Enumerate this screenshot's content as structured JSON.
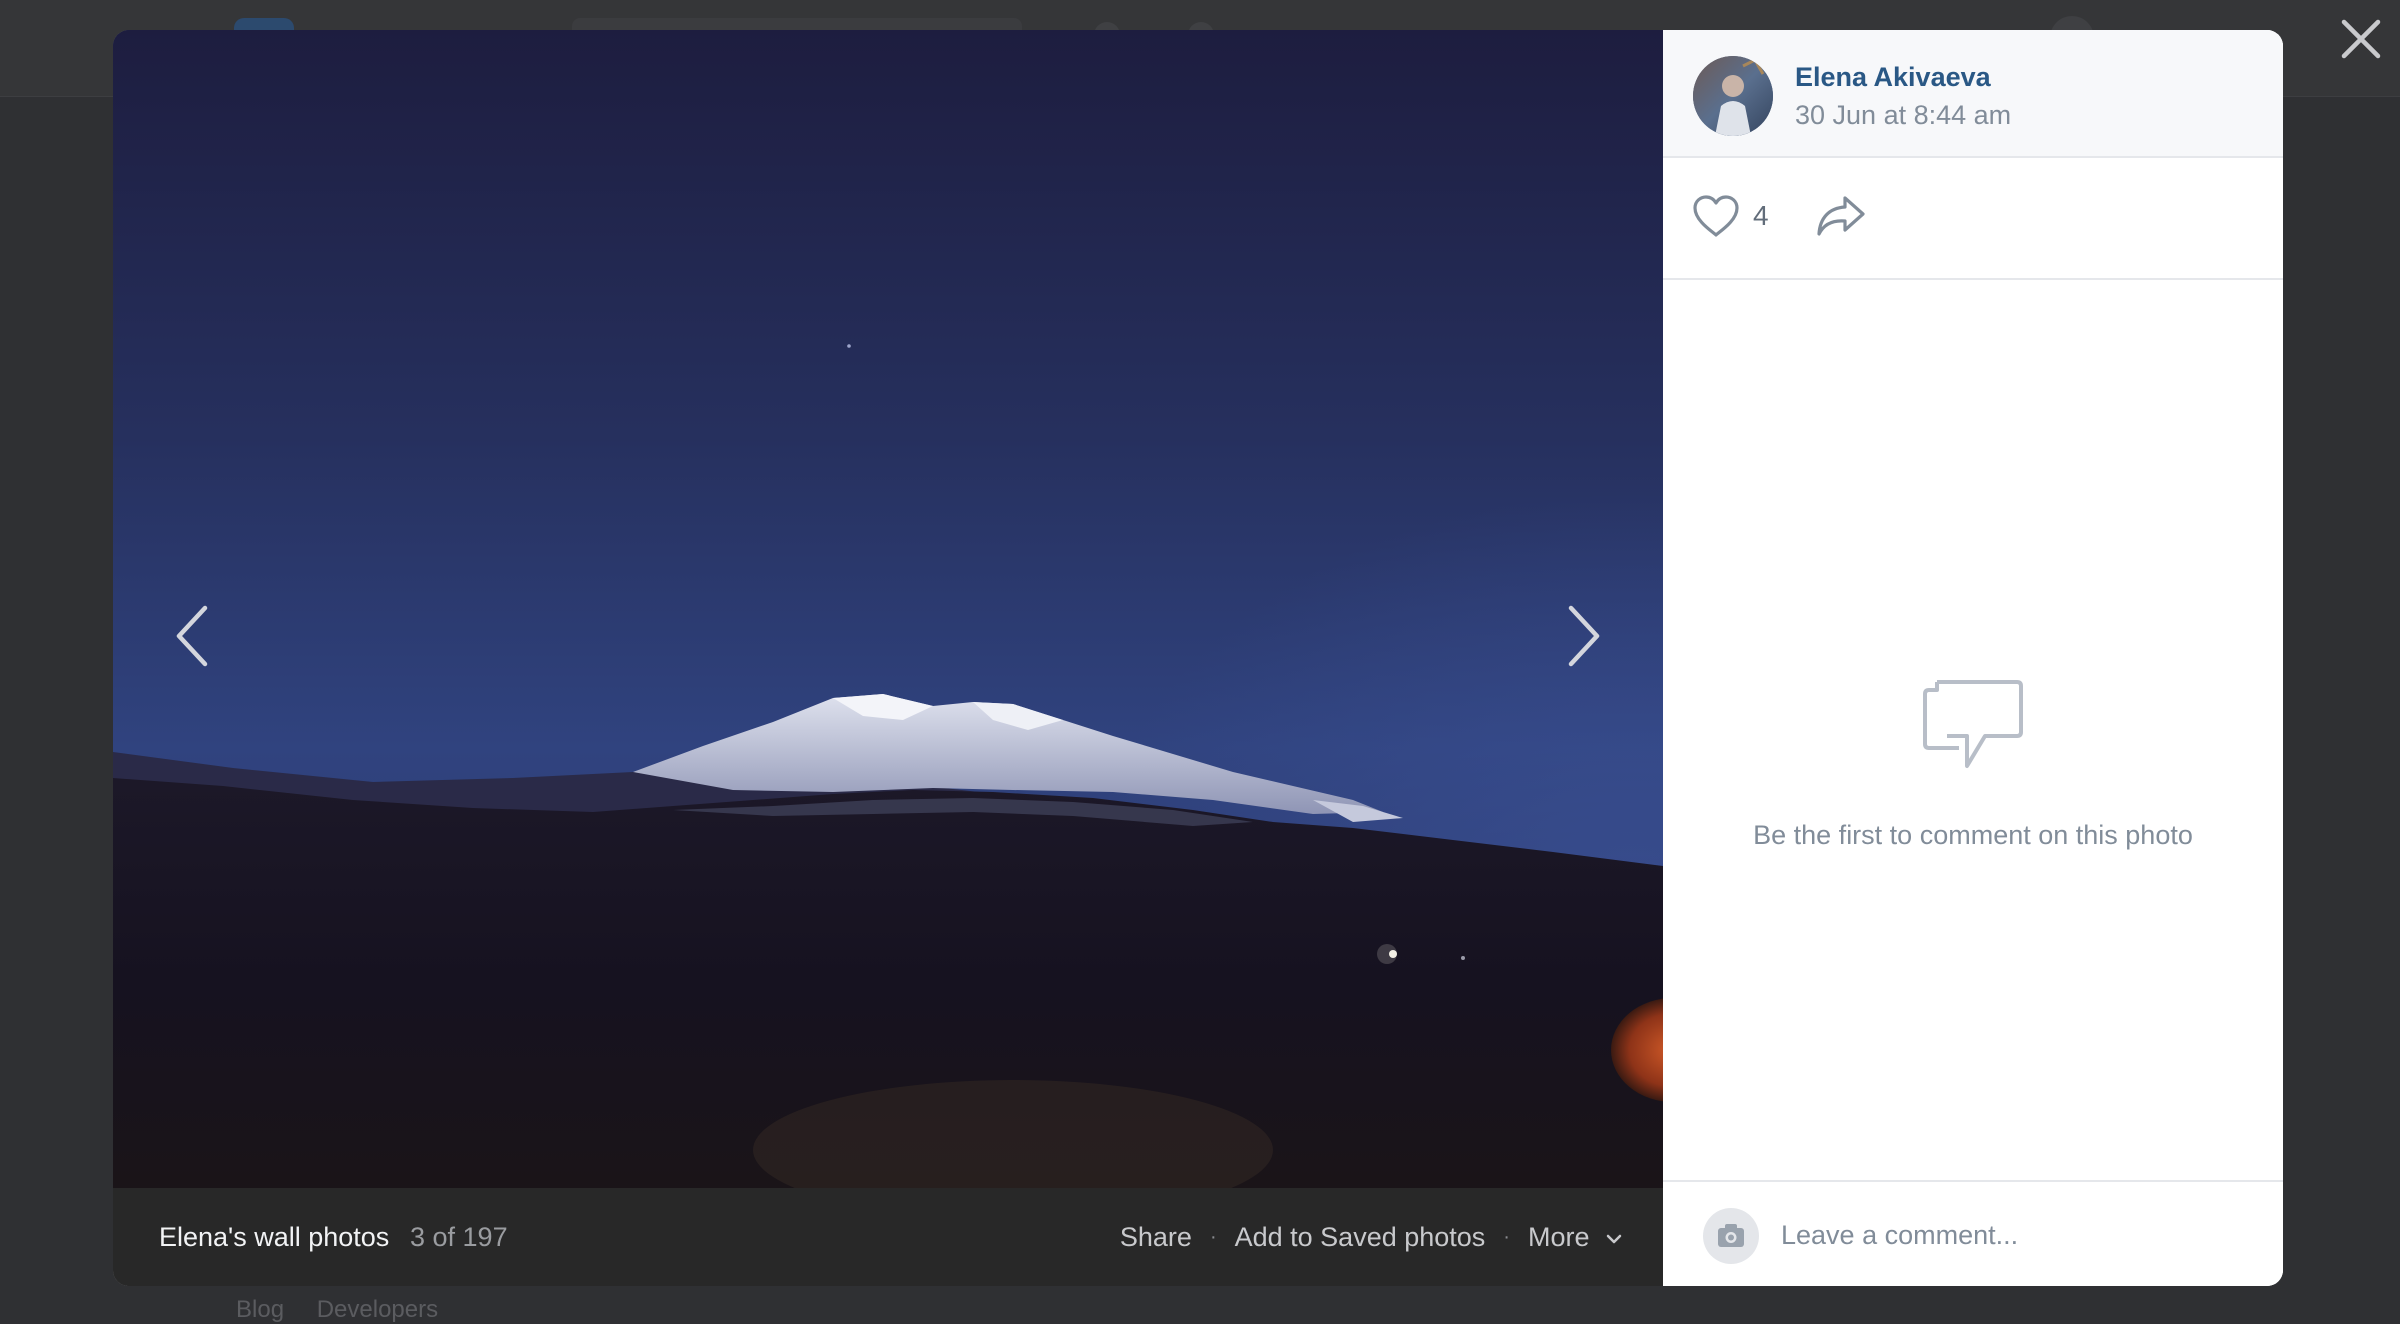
{
  "background": {
    "footer_links": [
      "Blog",
      "Developers"
    ]
  },
  "viewer": {
    "album_title": "Elena's wall photos",
    "counter": "3 of 197",
    "actions": {
      "share": "Share",
      "save": "Add to Saved photos",
      "more": "More"
    },
    "icons": {
      "prev": "chevron-left-icon",
      "next": "chevron-right-icon",
      "close": "close-icon",
      "more": "chevron-down-icon"
    }
  },
  "post": {
    "author": "Elena Akivaeva",
    "date": "30 Jun at 8:44 am",
    "likes": "4",
    "icons": {
      "like": "heart-icon",
      "share": "share-arrow-icon"
    }
  },
  "comments": {
    "empty_text": "Be the first to comment on this photo",
    "placeholder": "Leave a comment...",
    "icons": {
      "empty": "comments-icon",
      "attach": "camera-icon"
    }
  },
  "colors": {
    "link": "#2a5885",
    "muted": "#818c99",
    "overlay": "#2f3033"
  }
}
